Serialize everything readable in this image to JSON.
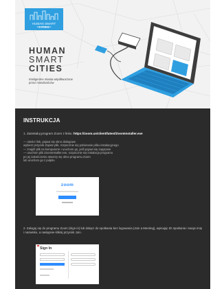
{
  "header": {
    "logo_text": "HUMAN SMART CITIES",
    "logo_subtext": "Interreg Europe",
    "title_line1": "HUMAN",
    "title_line2": "SMART",
    "title_line3": "CITIES",
    "subtitle": "Inteligentne miasta współtworzone przez mieszkańców"
  },
  "instructions": {
    "heading": "INSTRUKCJA",
    "step1_prefix": "1. Zainstaluj program Zoom z linku: ",
    "step1_link": "https://zoom.us/client/latest/ZoomInstaller.exe",
    "bullets": [
      "— otwórz link, pojawi się okno dialogowe",
      "  wybierz przycisk Zapisz plik, rozpocznie się pobieranie pliku instalacyjnego",
      "— znajdź plik na komputerze i uruchom go, jeśli pojawi się zapytanie",
      "— uruchom plik ZoomInstaller.exe, rozpocznie się instalacja programu",
      "  po jej zakończeniu otworzy się okno programu Zoom",
      "  lub uruchom go z pulpitu"
    ],
    "zoom_logo": "zoom",
    "para2": "2. Zaloguj się do programu Zoom (Sign in) lub dołącz do spotkania bez logowania (Join a Meeting), wpisując ID spotkania i swoje imię i nazwisko, a następnie kliknij przycisk Join.",
    "signin_label": "Sign In"
  }
}
